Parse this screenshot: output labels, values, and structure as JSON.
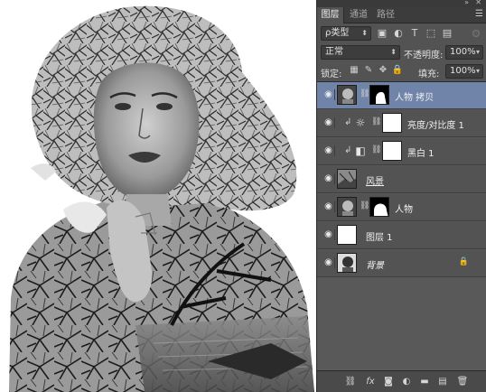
{
  "panel": {
    "tabs": [
      {
        "label": "图层",
        "active": true
      },
      {
        "label": "通道",
        "active": false
      },
      {
        "label": "路径",
        "active": false
      }
    ],
    "filter_dropdown": "ρ类型",
    "blend_mode": "正常",
    "opacity_label": "不透明度:",
    "opacity_value": "100%",
    "lock_label": "锁定:",
    "fill_label": "填充:",
    "fill_value": "100%"
  },
  "layers": [
    {
      "name": "人物 拷贝",
      "selected": true,
      "visible": true,
      "type": "mask-photo"
    },
    {
      "name": "亮度/对比度 1",
      "selected": false,
      "visible": true,
      "type": "brightness",
      "clipped": true
    },
    {
      "name": "黑白 1",
      "selected": false,
      "visible": true,
      "type": "bw",
      "clipped": true
    },
    {
      "name": "风景",
      "selected": false,
      "visible": true,
      "type": "photo-landscape"
    },
    {
      "name": "人物",
      "selected": false,
      "visible": true,
      "type": "mask-photo"
    },
    {
      "name": "图层 1",
      "selected": false,
      "visible": true,
      "type": "white"
    },
    {
      "name": "背景",
      "selected": false,
      "visible": true,
      "type": "background",
      "locked": true
    }
  ],
  "icons": {
    "eye": "eye-icon",
    "chain": "link-icon",
    "lock": "lock-icon",
    "menu": "panel-menu-icon"
  },
  "colors": {
    "panel_bg": "#535353",
    "selected_layer": "#6f84a8",
    "tab_bar": "#3c3c3c"
  }
}
